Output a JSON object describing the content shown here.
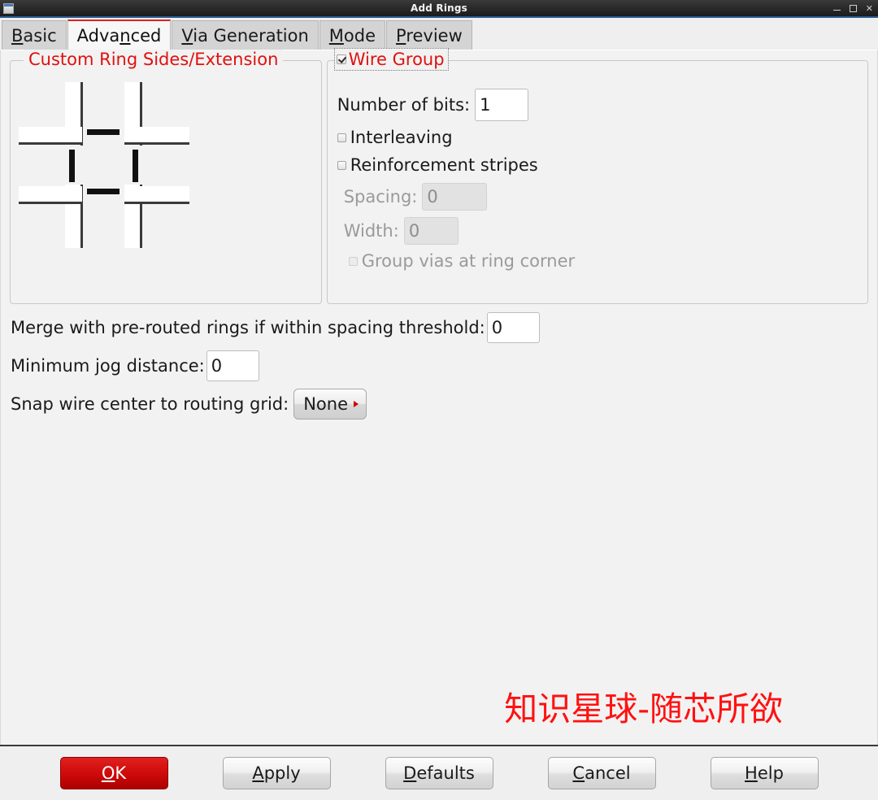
{
  "window": {
    "title": "Add Rings",
    "icon": "window-icon",
    "controls": {
      "minimize": "minimize-icon",
      "maximize": "maximize-icon",
      "close": "✕"
    }
  },
  "tabs": [
    {
      "label": "Basic",
      "mnemonic": "B",
      "before": "",
      "after": "asic",
      "active": false
    },
    {
      "label": "Advanced",
      "mnemonic": "n",
      "before": "Adva",
      "after": "ced",
      "active": true
    },
    {
      "label": "Via Generation",
      "mnemonic": "V",
      "before": "",
      "after": "ia Generation",
      "active": false
    },
    {
      "label": "Mode",
      "mnemonic": "M",
      "before": "",
      "after": "ode",
      "active": false
    },
    {
      "label": "Preview",
      "mnemonic": "P",
      "before": "",
      "after": "review",
      "active": false
    }
  ],
  "custom_ring_group": {
    "title": "Custom Ring Sides/Extension"
  },
  "wire_group": {
    "title": "Wire Group",
    "checked": true,
    "number_of_bits": {
      "label": "Number of bits:",
      "value": "1"
    },
    "interleaving": {
      "label": "Interleaving",
      "checked": false
    },
    "reinforcement_stripes": {
      "label": "Reinforcement stripes",
      "checked": false
    },
    "spacing": {
      "label": "Spacing:",
      "value": "0",
      "disabled": true
    },
    "width": {
      "label": "Width:",
      "value": "0",
      "disabled": true
    },
    "group_vias": {
      "label": "Group vias at ring corner",
      "checked": false,
      "disabled": true
    }
  },
  "options": {
    "merge": {
      "label": "Merge with pre-routed rings if within spacing threshold:",
      "value": "0"
    },
    "min_jog": {
      "label": "Minimum jog distance:",
      "value": "0"
    },
    "snap": {
      "label": "Snap wire center to routing grid:",
      "value": "None",
      "arrow": "chevron-right-icon"
    }
  },
  "watermark": "知识星球-随芯所欲",
  "buttons": [
    {
      "label": "OK",
      "before": "",
      "mnemonic": "O",
      "after": "K",
      "primary": true
    },
    {
      "label": "Apply",
      "before": "",
      "mnemonic": "A",
      "after": "pply",
      "primary": false
    },
    {
      "label": "Defaults",
      "before": "",
      "mnemonic": "D",
      "after": "efaults",
      "primary": false
    },
    {
      "label": "Cancel",
      "before": "",
      "mnemonic": "C",
      "after": "ancel",
      "primary": false
    },
    {
      "label": "Help",
      "before": "",
      "mnemonic": "H",
      "after": "elp",
      "primary": false
    }
  ],
  "colors": {
    "accent_red": "#e11010",
    "primary_button": "#cf0b0b",
    "titlebar": "#2b2b2b",
    "panel": "#f2f2f2"
  }
}
